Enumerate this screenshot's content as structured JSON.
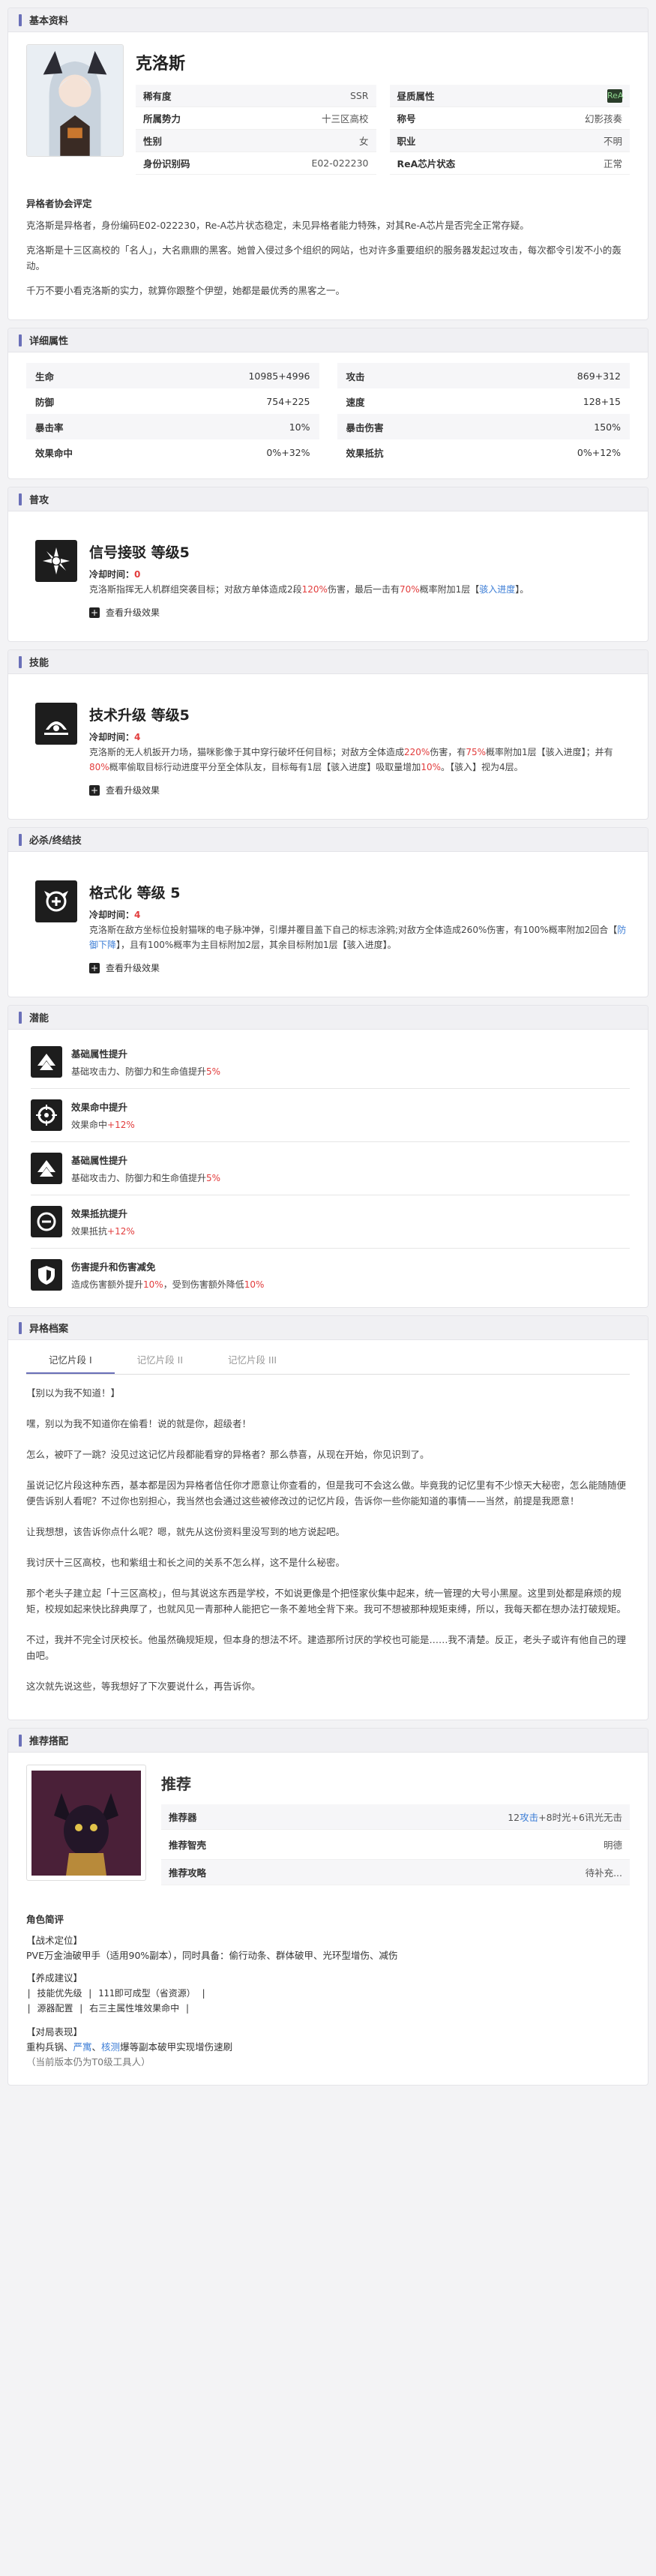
{
  "basic": {
    "header": "基本资料",
    "name": "克洛斯",
    "rows": [
      {
        "k": "稀有度",
        "v": "SSR",
        "k2": "昼质属性",
        "v2": ""
      },
      {
        "k": "所属势力",
        "v": "十三区高校",
        "k2": "称号",
        "v2": "幻影孩奏"
      },
      {
        "k": "性别",
        "v": "女",
        "k2": "职业",
        "v2": "不明"
      },
      {
        "k": "身份识别码",
        "v": "E02-022230",
        "k2": "ReA芯片状态",
        "v2": "正常"
      }
    ],
    "attr_icon": "ReA",
    "eval_title": "异格者协会评定",
    "eval": [
      "克洛斯是异格者，身份编码E02-022230，Re-A芯片状态稳定，未见异格者能力特殊，对其Re-A芯片是否完全正常存疑。",
      "克洛斯是十三区高校的「名人」，大名鼎鼎的黑客。她曾入侵过多个组织的网站，也对许多重要组织的服务器发起过攻击，每次都令引发不小的轰动。",
      "千万不要小看克洛斯的实力，就算你跟整个伊塑，她都是最优秀的黑客之一。"
    ]
  },
  "detail": {
    "header": "详细属性",
    "stats": [
      {
        "k": "生命",
        "v": "10985+4996",
        "k2": "攻击",
        "v2": "869+312"
      },
      {
        "k": "防御",
        "v": "754+225",
        "k2": "速度",
        "v2": "128+15"
      },
      {
        "k": "暴击率",
        "v": "10%",
        "k2": "暴击伤害",
        "v2": "150%"
      },
      {
        "k": "效果命中",
        "v": "0%+32%",
        "k2": "效果抵抗",
        "v2": "0%+12%"
      }
    ]
  },
  "normal": {
    "header": "普攻",
    "name": "信号接驳 等级5",
    "cd_label": "冷却时间：",
    "cd": "0",
    "d1": "克洛斯指挥无人机群组突袭目标；对敌方单体造成2段",
    "d2": "120%",
    "d3": "伤害，最后一击有",
    "d4": "70%",
    "d5": "概率附加1层【",
    "d6": "骇入进度",
    "d7": "】。",
    "more": "查看升级效果"
  },
  "skill": {
    "header": "技能",
    "name": "技术升级 等级5",
    "cd_label": "冷却时间：",
    "cd": "4",
    "d1": "克洛斯的无人机扳开力场，猫咪影像于其中穿行破坏任何目标；对敌方全体造成",
    "d2": "220%",
    "d3": "伤害，有",
    "d4": "75%",
    "d5": "概率附加1层【骇入进度】；并有",
    "d6": "80%",
    "d7": "概率偷取目标行动进度平分至全体队友，目标每有1层【骇入进度】吸取量增加",
    "d8": "10%",
    "d9": "。【骇入】视为4层。",
    "more": "查看升级效果"
  },
  "ult": {
    "header": "必杀/终结技",
    "name": "格式化 等级 5",
    "cd_label": "冷却时间：",
    "cd": "4",
    "d1": "克洛斯在敌方坐标位投射猫咪的电子脉冲弹，引爆并覆目盖下自己的标志涂鸦;对敌方全体造成260%伤害，有100%概率附加2回合【",
    "d2": "防御下降",
    "d3": "】，且有100%概率为主目标附加2层，其余目标附加1层【骇入进度】。",
    "more": "查看升级效果"
  },
  "potential": {
    "header": "潜能",
    "items": [
      {
        "name": "基础属性提升",
        "a": "基础攻击力、防御力和生命值提升",
        "b": "5%",
        "icon": "arrow"
      },
      {
        "name": "效果命中提升",
        "a": "效果命中",
        "b": "+12%",
        "icon": "target"
      },
      {
        "name": "基础属性提升",
        "a": "基础攻击力、防御力和生命值提升",
        "b": "5%",
        "icon": "arrow"
      },
      {
        "name": "效果抵抗提升",
        "a": "效果抵抗",
        "b": "+12%",
        "icon": "resist"
      },
      {
        "name": "伤害提升和伤害减免",
        "a": "造成伤害额外提升",
        "b": "10%",
        "c": "，受到伤害额外降低",
        "d": "10%",
        "icon": "shield"
      }
    ]
  },
  "archive": {
    "header": "异格档案",
    "tabs": [
      "记忆片段 I",
      "记忆片段 II",
      "记忆片段 III"
    ],
    "paras": [
      "【别以为我不知道！】",
      "嘿，别以为我不知道你在偷看！说的就是你，超级者！",
      "怎么，被吓了一跳？没见过这记忆片段都能看穿的异格者？那么恭喜，从现在开始，你见识到了。",
      "虽说记忆片段这种东西，基本都是因为异格者信任你才愿意让你查看的，但是我可不会这么做。毕竟我的记忆里有不少惊天大秘密，怎么能随随便便告诉别人看呢？不过你也别担心，我当然也会通过这些被修改过的记忆片段，告诉你一些你能知道的事情——当然，前提是我愿意！",
      "让我想想，该告诉你点什么呢？嗯，就先从这份资料里没写到的地方说起吧。",
      "我讨厌十三区高校，也和紫组士和长之间的关系不怎么样，这不是什么秘密。",
      "那个老头子建立起「十三区高校」，但与其说这东西是学校，不如说更像是个把怪家伙集中起来，统一管理的大号小黑屋。这里到处都是麻烦的规矩，校规如起来快比辞典厚了，也就风见一青那种人能把它一条不差地全背下来。我可不想被那种规矩束缚，所以，我每天都在想办法打破规矩。",
      "不过，我并不完全讨厌校长。他虽然确规矩规，但本身的想法不坏。建造那所讨厌的学校也可能是……我不清楚。反正，老头子或许有他自己的理由吧。",
      "这次就先说这些，等我想好了下次要说什么，再告诉你。"
    ]
  },
  "recommend": {
    "header": "推荐搭配",
    "title": "推荐",
    "rows": [
      {
        "k": "推荐器",
        "v1": "12",
        "v2": "攻击",
        "v3": "+8时光+6讯光无击"
      },
      {
        "k": "推荐智壳",
        "v": "明德"
      },
      {
        "k": "推荐攻略",
        "v": "待补充..."
      }
    ],
    "role_title": "角色简评",
    "r1": "【战术定位】",
    "r2": "PVE万金油破甲手（适用90%副本），同时具备：偷行动条、群体破甲、光环型增伤、减伤",
    "r3": "【养成建议】",
    "r4": "| 技能优先级 | 111即可成型（省资源） |",
    "r5": "| 源器配置 | 右三主属性堆效果命中 |",
    "r6": "【对局表现】",
    "r7a": "重构兵锅、",
    "r7b": "严寓",
    "r7c": "、",
    "r7d": "核测",
    "r7e": "爆等副本破甲实现增伤速刷",
    "r8": "（当前版本仍为T0级工具人）"
  }
}
